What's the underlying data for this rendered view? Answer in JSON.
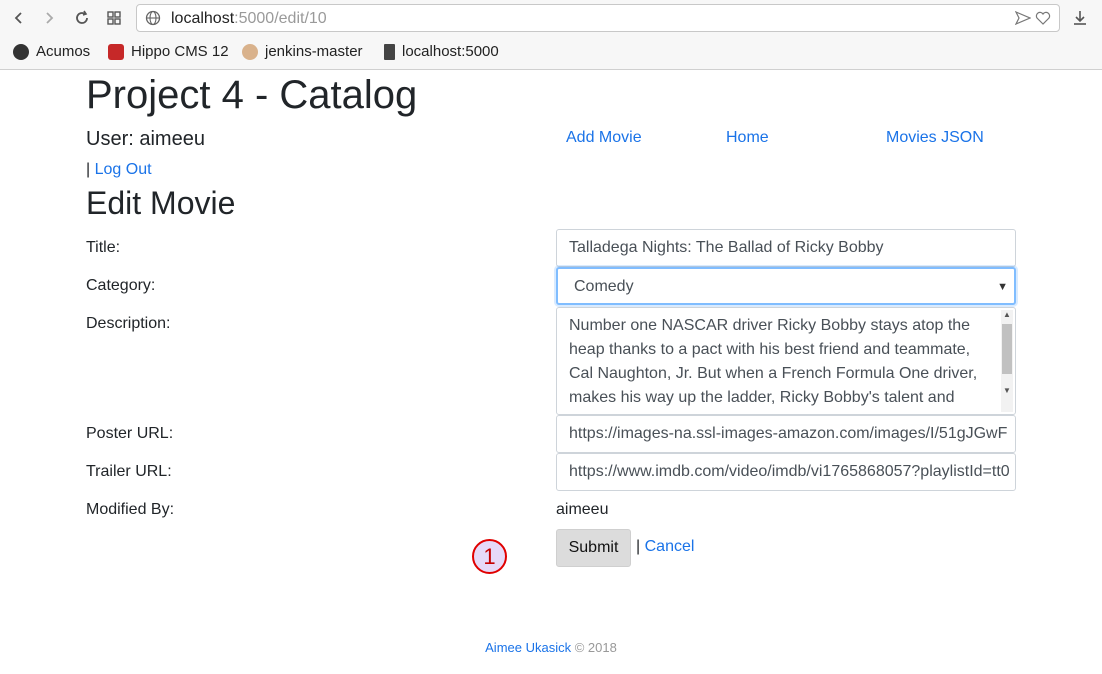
{
  "browser": {
    "url_host": "localhost",
    "url_path": ":5000/edit/10",
    "bookmarks": [
      {
        "label": "Acumos",
        "icon": "acumos-icon"
      },
      {
        "label": "Hippo CMS 12",
        "icon": "hippo-icon"
      },
      {
        "label": "jenkins-master",
        "icon": "jenkins-icon"
      },
      {
        "label": "localhost:5000",
        "icon": "page-icon"
      }
    ]
  },
  "header": {
    "title": "Project 4 - Catalog",
    "user_label": "User: aimeeu",
    "nav": [
      "Add Movie",
      "Home",
      "Movies JSON"
    ],
    "logout_sep": "| ",
    "logout": "Log Out"
  },
  "form": {
    "heading": "Edit Movie",
    "title_label": "Title:",
    "title_value": "Talladega Nights: The Ballad of Ricky Bobby",
    "category_label": "Category:",
    "category_value": "Comedy",
    "description_label": "Description:",
    "description_value": "Number one NASCAR driver Ricky Bobby stays atop the heap thanks to a pact with his best friend and teammate, Cal Naughton, Jr. But when a French Formula One driver, makes his way up the ladder, Ricky Bobby's talent and",
    "poster_label": "Poster URL:",
    "poster_value": "https://images-na.ssl-images-amazon.com/images/I/51gJGwF",
    "trailer_label": "Trailer URL:",
    "trailer_value": "https://www.imdb.com/video/imdb/vi1765868057?playlistId=tt0",
    "modified_label": "Modified By:",
    "modified_value": "aimeeu",
    "submit": "Submit",
    "sep": "| ",
    "cancel": "Cancel"
  },
  "annotation": {
    "marker": "1"
  },
  "footer": {
    "author": "Aimee Ukasick",
    "copyright": " © 2018"
  },
  "colors": {
    "link": "#1a73e8",
    "focus_border": "#80bdff",
    "marker": "#e00000"
  }
}
